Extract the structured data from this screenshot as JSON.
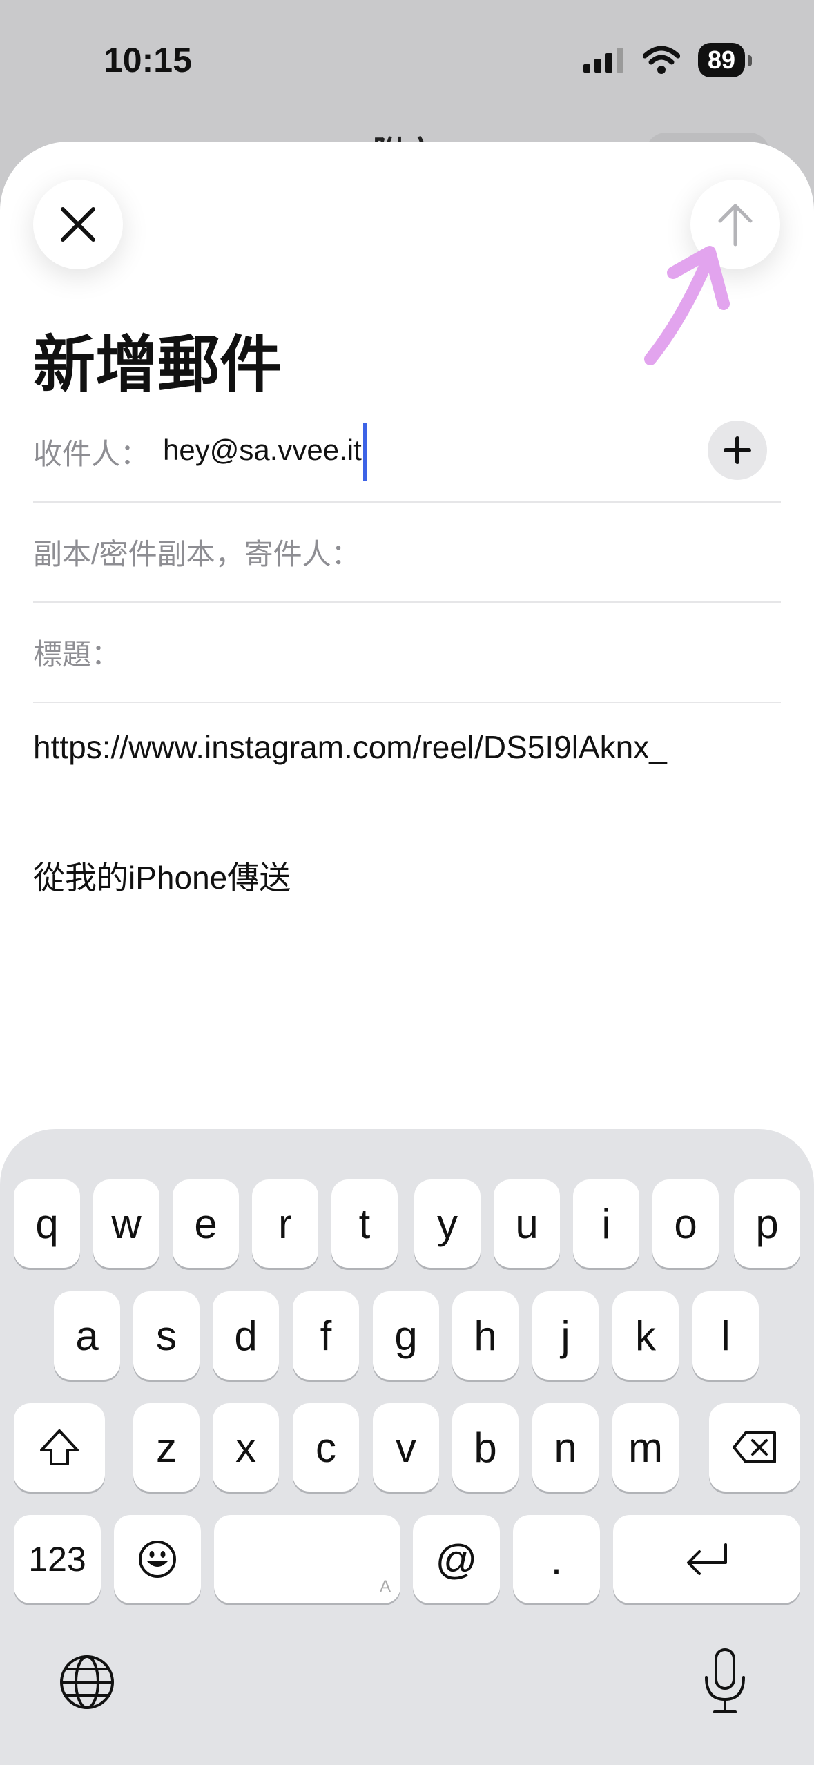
{
  "status_bar": {
    "time": "10:15",
    "battery": "89"
  },
  "background": {
    "partial_title": "附文"
  },
  "compose": {
    "title": "新增郵件",
    "to_label": "收件人：",
    "to_value": "hey@sa.vvee.it",
    "cc_label": "副本/密件副本，寄件人：",
    "subject_label": "標題：",
    "body_link": "https://www.instagram.com/reel/DS5I9lAknx_",
    "signature": "從我的iPhone傳送"
  },
  "keyboard": {
    "row1": [
      "q",
      "w",
      "e",
      "r",
      "t",
      "y",
      "u",
      "i",
      "o",
      "p"
    ],
    "row2": [
      "a",
      "s",
      "d",
      "f",
      "g",
      "h",
      "j",
      "k",
      "l"
    ],
    "row3": [
      "z",
      "x",
      "c",
      "v",
      "b",
      "n",
      "m"
    ],
    "numbers_key": "123",
    "at_key": "@",
    "period_key": ".",
    "space_hint": "A"
  },
  "colors": {
    "accent": "#3d63e6",
    "annotation": "#e2a4ee"
  }
}
